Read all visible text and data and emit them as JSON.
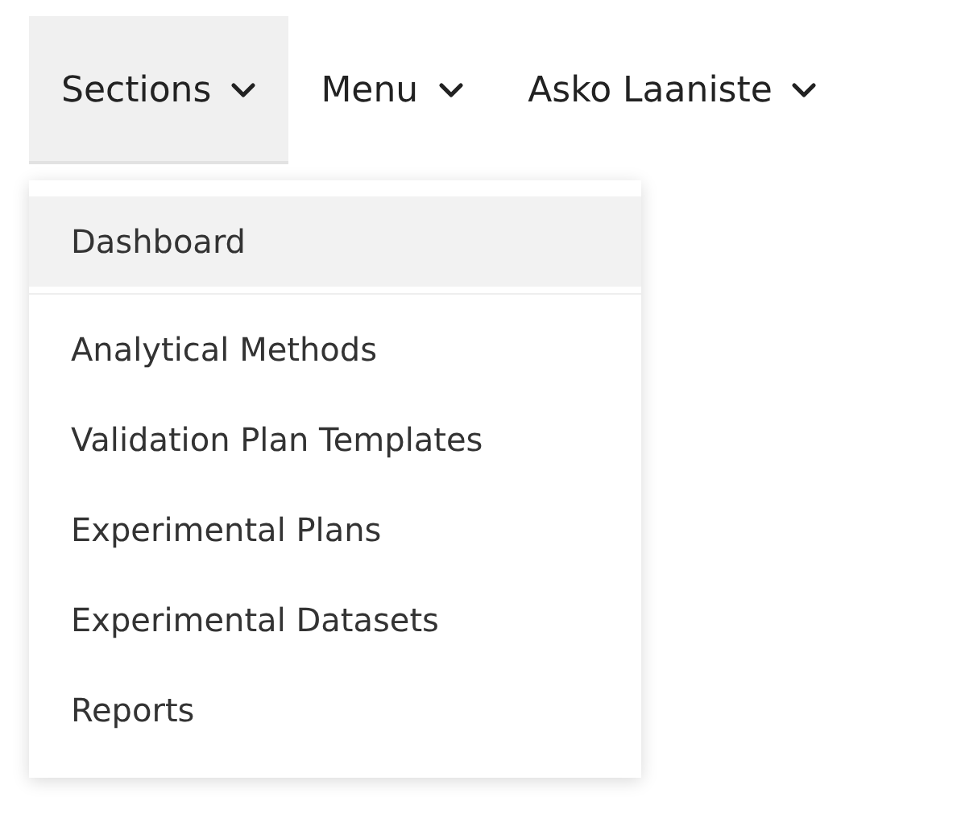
{
  "nav": [
    {
      "label": "Sections",
      "expanded": true
    },
    {
      "label": "Menu",
      "expanded": false
    },
    {
      "label": "Asko Laaniste",
      "expanded": false
    }
  ],
  "dropdown": {
    "items": [
      {
        "label": "Dashboard",
        "selected": true,
        "divider_after": true
      },
      {
        "label": "Analytical Methods",
        "selected": false,
        "divider_after": false
      },
      {
        "label": "Validation Plan Templates",
        "selected": false,
        "divider_after": false
      },
      {
        "label": "Experimental Plans",
        "selected": false,
        "divider_after": false
      },
      {
        "label": "Experimental Datasets",
        "selected": false,
        "divider_after": false
      },
      {
        "label": "Reports",
        "selected": false,
        "divider_after": false
      }
    ]
  }
}
